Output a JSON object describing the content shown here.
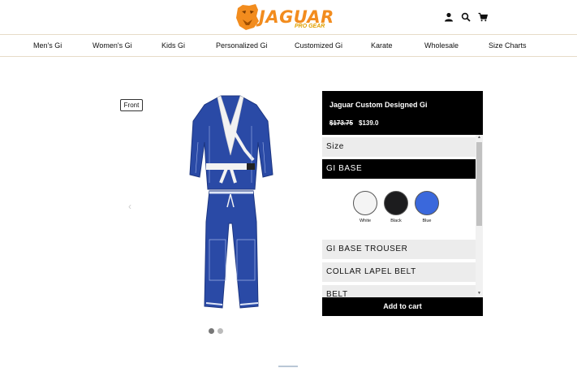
{
  "brand": {
    "name": "JAGUAR",
    "tagline": "PRO GEAR"
  },
  "header_icons": [
    "user-icon",
    "search-icon",
    "cart-icon"
  ],
  "nav": {
    "items": [
      "Men's Gi",
      "Women's Gi",
      "Kids Gi",
      "Personalized Gi",
      "Customized Gi",
      "Karate",
      "Wholesale",
      "Size Charts"
    ]
  },
  "viewer": {
    "view_label": "Front",
    "slide_count": 2,
    "active_slide": 1
  },
  "product": {
    "title": "Jaguar Custom Designed Gi",
    "old_price": "$173.75",
    "price": "$139.0"
  },
  "options": {
    "size": "Size",
    "gi_base": "GI BASE",
    "gi_base_trouser": "GI BASE TROUSER",
    "collar_lapel_belt": "COLLAR LAPEL BELT",
    "belt": "BELT"
  },
  "swatches": [
    {
      "label": "White",
      "color": "#f4f4f4"
    },
    {
      "label": "Black",
      "color": "#1c1c1e"
    },
    {
      "label": "Blue",
      "color": "#3a68dc"
    }
  ],
  "add_to_cart": "Add to cart",
  "colors": {
    "brand_orange": "#f28c1e",
    "gi_blue": "#2a4aa6",
    "panel_black": "#000000"
  }
}
